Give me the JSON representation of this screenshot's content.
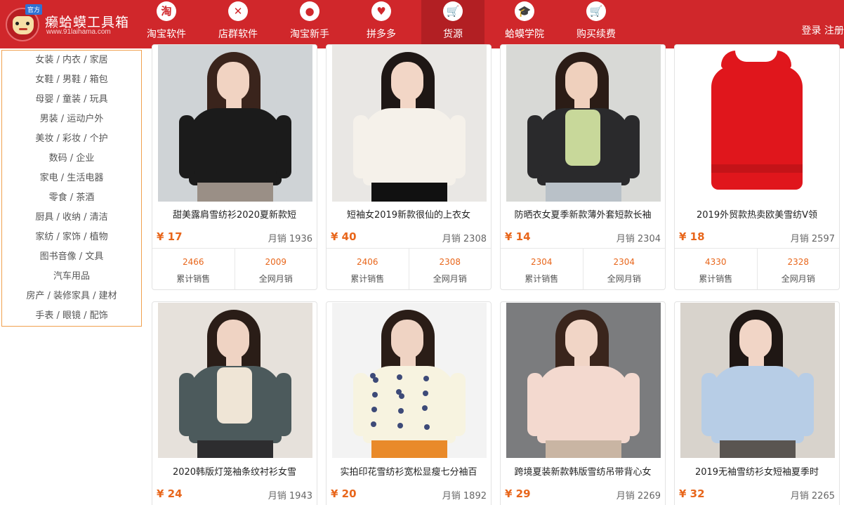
{
  "header": {
    "logo_tag": "官方",
    "logo_title": "癞蛤蟆工具箱",
    "logo_url": "www.91laihama.com",
    "nav": [
      {
        "label": "淘宝软件",
        "icon": "taobao-icon",
        "glyph": "淘"
      },
      {
        "label": "店群软件",
        "icon": "shop-group-icon",
        "glyph": "✕"
      },
      {
        "label": "淘宝新手",
        "icon": "user-icon",
        "glyph": "●"
      },
      {
        "label": "拼多多",
        "icon": "heart-icon",
        "glyph": "♥"
      },
      {
        "label": "货源",
        "icon": "cart-icon",
        "glyph": "🛒",
        "active": true
      },
      {
        "label": "蛤蟆学院",
        "icon": "graduation-cap-icon",
        "glyph": "🎓"
      },
      {
        "label": "购买续费",
        "icon": "cart-icon",
        "glyph": "🛒"
      }
    ],
    "login": "登录",
    "register": "注册"
  },
  "sidebar": {
    "categories": [
      "女装 / 内衣 / 家居",
      "女鞋 / 男鞋 / 箱包",
      "母婴 / 童装 / 玩具",
      "男装 / 运动户外",
      "美妆 / 彩妆 / 个护",
      "数码 / 企业",
      "家电 / 生活电器",
      "零食 / 茶酒",
      "厨具 / 收纳 / 清洁",
      "家纺 / 家饰 / 植物",
      "图书音像 / 文具",
      "汽车用品",
      "房产 / 装修家具 / 建材",
      "手表 / 眼镜 / 配饰"
    ]
  },
  "labels": {
    "monthly_sales_prefix": "月销",
    "cumulative_sales": "累计销售",
    "network_monthly": "全网月销"
  },
  "products": [
    {
      "title": "甜美露肩雪纺衫2020夏新款短",
      "price": "¥ 17",
      "monthly": "1936",
      "cumulative": "2466",
      "network": "2009",
      "colors": {
        "bg": "#cfd3d6",
        "garment": "#1b1b1b",
        "skin": "#f1d3c2",
        "hair": "#3a241c",
        "bottom": "#9a8f86"
      }
    },
    {
      "title": "短袖女2019新款很仙的上衣女",
      "price": "¥ 40",
      "monthly": "2308",
      "cumulative": "2406",
      "network": "2308",
      "colors": {
        "bg": "#e9e7e4",
        "garment": "#f5f1ea",
        "skin": "#f2d6c6",
        "hair": "#1e1715",
        "bottom": "#111111"
      }
    },
    {
      "title": "防晒衣女夏季新款薄外套短款长袖",
      "price": "¥ 14",
      "monthly": "2304",
      "cumulative": "2304",
      "network": "2304",
      "colors": {
        "bg": "#d8d9d6",
        "garment": "#2a2a2c",
        "skin": "#efd0bd",
        "hair": "#2b1c16",
        "bottom": "#b9c1c8",
        "inner": "#c8d89a"
      }
    },
    {
      "title": "2019外贸款热卖欧美雪纺V领",
      "price": "¥ 18",
      "monthly": "2597",
      "cumulative": "4330",
      "network": "2328",
      "colors": {
        "bg": "#ffffff",
        "garment": "#e0161c"
      }
    },
    {
      "title": "2020韩版灯笼袖条纹衬衫女雪",
      "price": "¥ 24",
      "monthly": "1943",
      "colors": {
        "bg": "#e6e1db",
        "garment": "#4c5a5c",
        "skin": "#efd3c3",
        "hair": "#2a1d17",
        "bottom": "#2d2d2f",
        "inner": "#efe5d6"
      }
    },
    {
      "title": "实拍印花雪纺衫宽松显瘦七分袖百",
      "price": "¥ 20",
      "monthly": "1892",
      "colors": {
        "bg": "#f3f3f3",
        "garment": "#f7f3e0",
        "skin": "#efd3c3",
        "hair": "#2a1d17",
        "bottom": "#e98a2a",
        "print": "#3d4a78"
      }
    },
    {
      "title": "跨境夏装新款韩版雪纺吊带背心女",
      "price": "¥ 29",
      "monthly": "2269",
      "colors": {
        "bg": "#7b7c7e",
        "garment": "#f3d9cf",
        "skin": "#f1d5c6",
        "hair": "#3a251c",
        "bottom": "#c9b5a3"
      }
    },
    {
      "title": "2019无袖雪纺衫女短袖夏季时",
      "price": "¥ 32",
      "monthly": "2265",
      "colors": {
        "bg": "#d8d3cc",
        "garment": "#b7cde6",
        "skin": "#f1d5c6",
        "hair": "#1f1714",
        "bottom": "#5a5551"
      }
    }
  ]
}
